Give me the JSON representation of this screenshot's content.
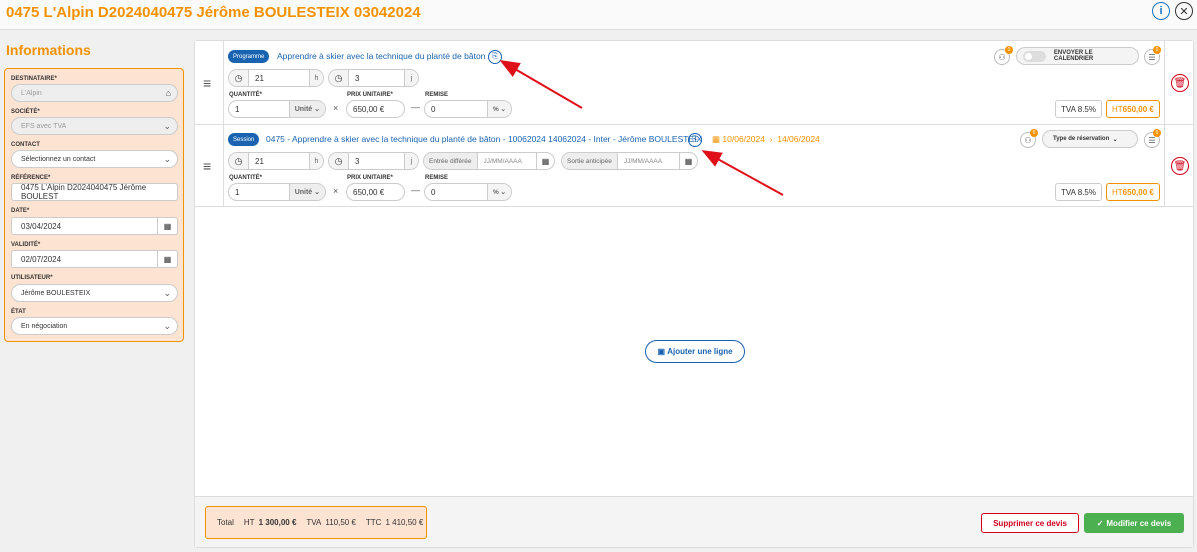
{
  "header": {
    "title": "0475 L'Alpin D2024040475 Jérôme BOULESTEIX 03042024",
    "info_icon": "info-icon",
    "close_icon": "close-icon"
  },
  "sidebar": {
    "title": "Informations",
    "destinataire": {
      "label": "DESTINATAIRE*",
      "value": "L'Alpin"
    },
    "societe": {
      "label": "SOCIÉTÉ*",
      "value": "EFS avec TVA"
    },
    "contact": {
      "label": "CONTACT",
      "value": "Sélectionnez un contact"
    },
    "reference": {
      "label": "RÉFÉRENCE*",
      "value": "0475 L'Alpin D2024040475 Jérôme BOULEST"
    },
    "date": {
      "label": "DATE*",
      "value": "03/04/2024"
    },
    "validite": {
      "label": "VALIDITÉ*",
      "value": "02/07/2024"
    },
    "utilisateur": {
      "label": "UTILISATEUR*",
      "value": "Jérôme BOULESTEIX"
    },
    "etat": {
      "label": "ÉTAT",
      "value": "En négociation"
    }
  },
  "lines": [
    {
      "badge": "Programme",
      "title": "Apprendre à skier avec la technique du planté de bâton",
      "hours": "21",
      "hours_unit": "h",
      "days": "3",
      "days_unit": "j",
      "quantite_label": "QUANTITÉ*",
      "quantite": "1",
      "unit": "Unité",
      "prix_label": "PRIX UNITAIRE*",
      "prix": "650,00 €",
      "remise_label": "REMISE",
      "remise": "0",
      "remise_unit": "%",
      "tva": "TVA 8.5%",
      "ht_prefix": "HT",
      "ht_value": "650,00 €",
      "participants_count": "0",
      "calendar_button": "ENVOYER LE CALENDRIER",
      "list_count": "0"
    },
    {
      "badge": "Session",
      "title": "0475 - Apprendre à skier avec la technique du planté de bâton - 10062024 14062024 - Inter - Jérôme BOULESTEIX",
      "date_start": "10/06/2024",
      "date_end": "14/06/2024",
      "hours": "21",
      "hours_unit": "h",
      "days": "3",
      "days_unit": "j",
      "entree_label": "Entrée différée",
      "entree_placeholder": "JJ/MM/AAAA",
      "sortie_label": "Sortie anticipée",
      "sortie_placeholder": "JJ/MM/AAAA",
      "quantite_label": "QUANTITÉ*",
      "quantite": "1",
      "unit": "Unité",
      "prix_label": "PRIX UNITAIRE*",
      "prix": "650,00 €",
      "remise_label": "REMISE",
      "remise": "0",
      "remise_unit": "%",
      "tva": "TVA 8.5%",
      "ht_prefix": "HT",
      "ht_value": "650,00 €",
      "participants_count": "0",
      "reservation_button": "Type de réservation",
      "list_count": "0"
    }
  ],
  "add_line": "Ajouter une ligne",
  "footer": {
    "total_label": "Total",
    "ht_label": "HT",
    "ht_value": "1 300,00 €",
    "tva_label": "TVA",
    "tva_value": "110,50 €",
    "ttc_label": "TTC",
    "ttc_value": "1 410,50 €",
    "delete_button": "Supprimer ce devis",
    "save_button": "Modifier ce devis"
  },
  "colors": {
    "accent_orange": "#f39200",
    "link_blue": "#1a63b0",
    "danger_red": "#d0021b",
    "success_green": "#4caf50",
    "annotation_red": "#e0101a"
  }
}
